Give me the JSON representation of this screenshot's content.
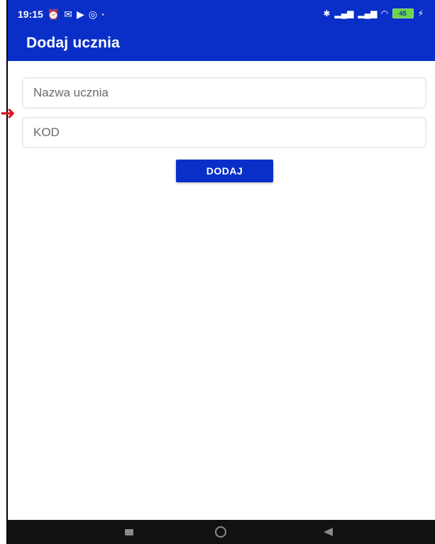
{
  "status_bar": {
    "time": "19:15",
    "battery": "45"
  },
  "header": {
    "title": "Dodaj ucznia"
  },
  "form": {
    "name_placeholder": "Nazwa ucznia",
    "code_placeholder": "KOD",
    "submit_label": "DODAJ"
  },
  "nav_bar": {
    "recent_icon": "square-icon",
    "home_icon": "circle-icon",
    "back_icon": "triangle-left-icon"
  },
  "colors": {
    "primary": "#0a2fc8",
    "annotation_arrow": "#e0151f"
  }
}
